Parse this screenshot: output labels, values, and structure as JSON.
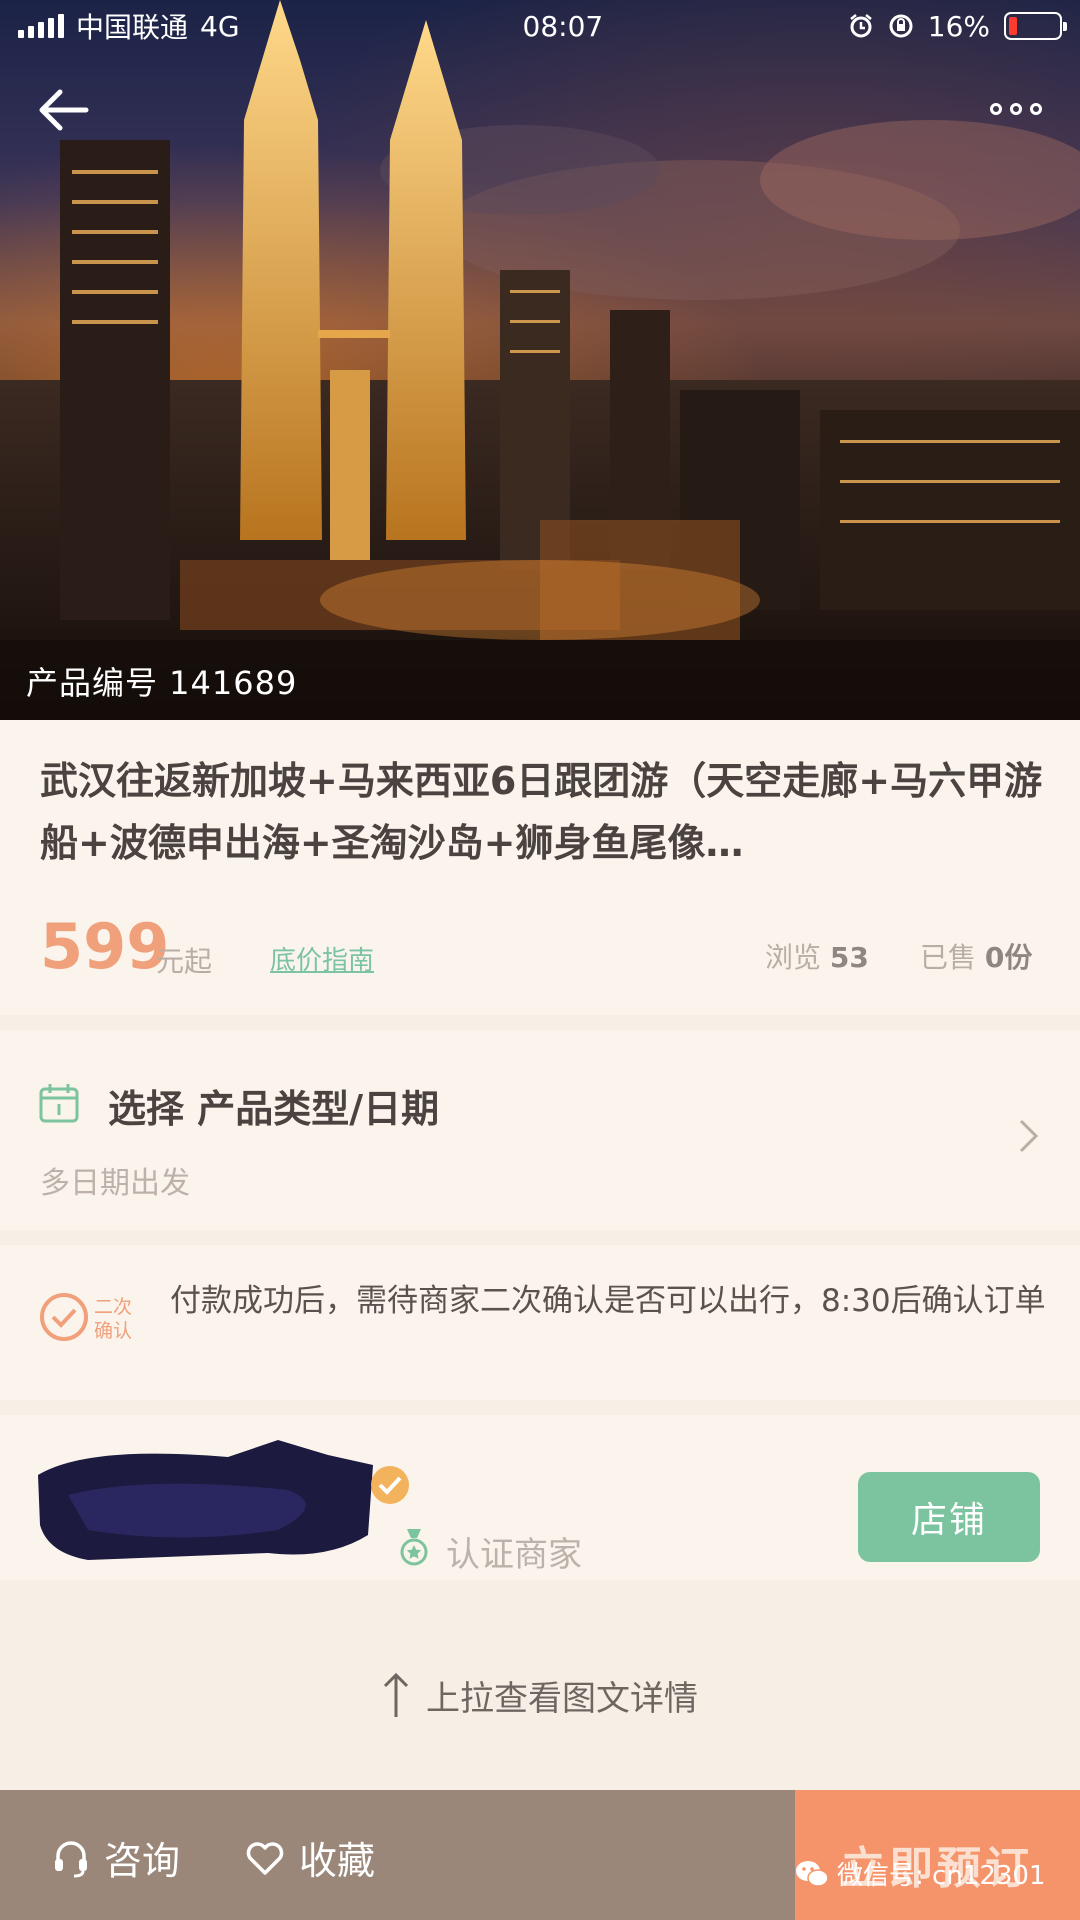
{
  "status_bar": {
    "carrier": "中国联通",
    "network": "4G",
    "time": "08:07",
    "battery_percent": "16%",
    "battery_level": 0.16
  },
  "hero": {
    "product_code": "产品编号 141689"
  },
  "product": {
    "title": "武汉往返新加坡+马来西亚6日跟团游（天空走廊+马六甲游船+波德申出海+圣淘沙岛+狮身鱼尾像…",
    "price": "599",
    "price_unit": "元起",
    "price_guide": "底价指南",
    "views_label": "浏览",
    "views_value": "53",
    "sold_label": "已售",
    "sold_value": "0份"
  },
  "select": {
    "title": "选择 产品类型/日期",
    "subtitle": "多日期出发"
  },
  "notice": {
    "badge": "二次确认",
    "text": "付款成功后，需待商家二次确认是否可以出行，8:30后确认订单"
  },
  "merchant": {
    "cert_label": "认证商家",
    "shop_button": "店铺"
  },
  "pull_hint": "上拉查看图文详情",
  "bottom_bar": {
    "consult": "咨询",
    "favorite": "收藏",
    "book": "立即预订"
  },
  "watermark": "微信号: cn12301",
  "colors": {
    "accent_price": "#f0a07a",
    "accent_green": "#7cc3a0",
    "book_button": "#f5946b",
    "bottom_bar": "#9a877a"
  }
}
